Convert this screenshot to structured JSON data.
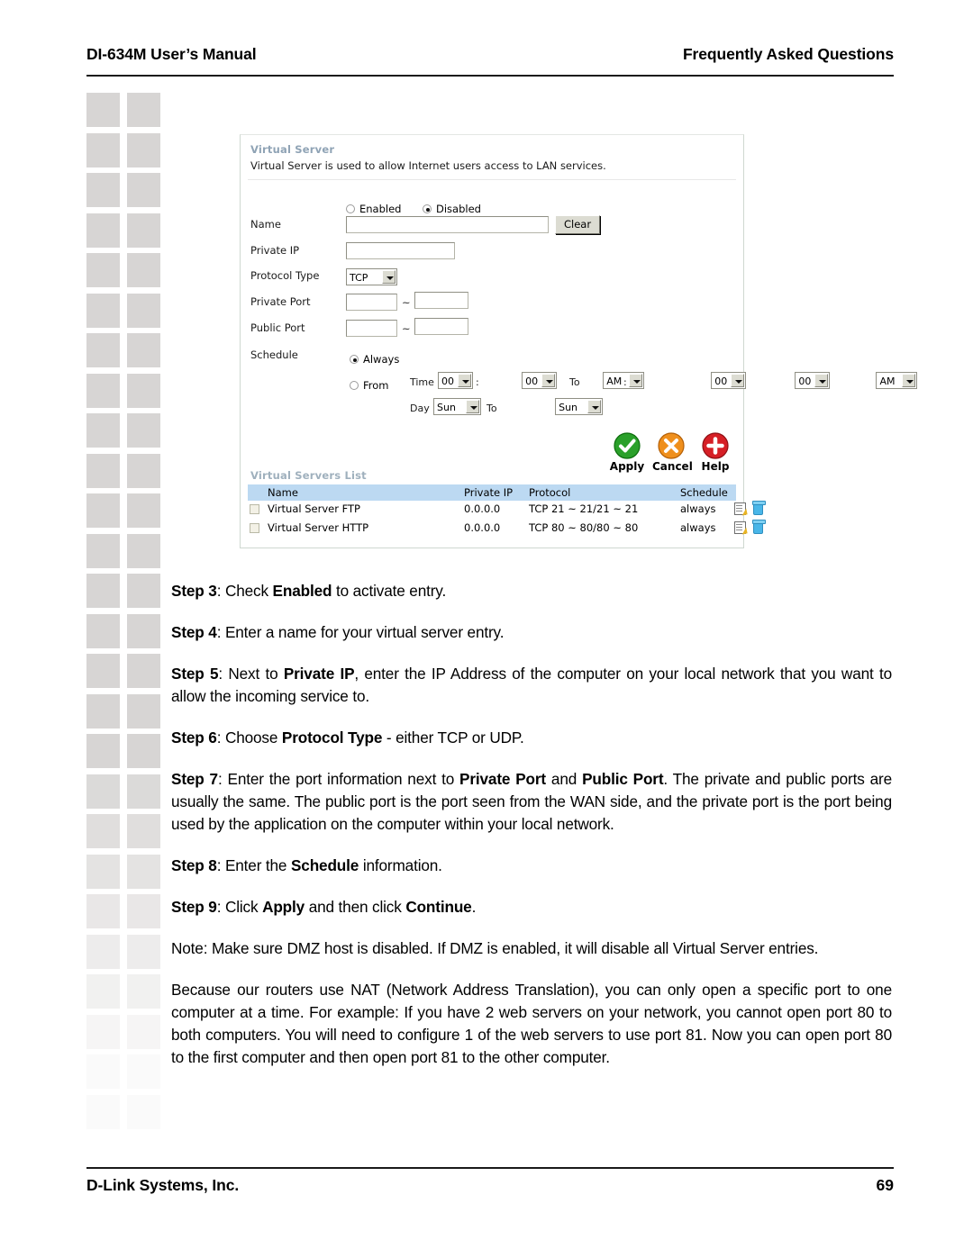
{
  "header": {
    "left": "DI-634M User’s Manual",
    "right": "Frequently Asked Questions"
  },
  "footer": {
    "left": "D-Link Systems, Inc.",
    "page_number": "69"
  },
  "screenshot": {
    "title": "Virtual Server",
    "description": "Virtual Server is used to allow Internet users access to LAN services.",
    "enable_radio": {
      "enabled_label": "Enabled",
      "disabled_label": "Disabled",
      "selected": "Disabled"
    },
    "fields": {
      "name_label": "Name",
      "name_value": "",
      "clear_button": "Clear",
      "private_ip_label": "Private IP",
      "private_ip_value": "",
      "protocol_type_label": "Protocol Type",
      "protocol_type_value": "TCP",
      "private_port_label": "Private Port",
      "private_port_from": "",
      "private_port_to": "",
      "public_port_label": "Public Port",
      "public_port_from": "",
      "public_port_to": "",
      "range_separator": "~"
    },
    "schedule": {
      "label": "Schedule",
      "always_label": "Always",
      "from_label": "From",
      "time_label": "Time",
      "to_label": "To",
      "day_label": "Day",
      "selected": "Always",
      "start_hour": "00",
      "start_minute": "00",
      "start_meridiem": "AM",
      "end_hour": "00",
      "end_minute": "00",
      "end_meridiem": "AM",
      "start_day": "Sun",
      "end_day": "Sun",
      "colon": ":"
    },
    "actions": [
      {
        "icon": "check-circle-icon",
        "label": "Apply",
        "color": "#2aa02a"
      },
      {
        "icon": "x-circle-icon",
        "label": "Cancel",
        "color": "#ef8f1c"
      },
      {
        "icon": "plus-circle-icon",
        "label": "Help",
        "color": "#d61f26"
      }
    ],
    "list": {
      "title": "Virtual Servers List",
      "columns": [
        "Name",
        "Private IP",
        "Protocol",
        "Schedule"
      ],
      "rows": [
        {
          "name": "Virtual Server FTP",
          "private_ip": "0.0.0.0",
          "protocol": "TCP 21 ~ 21/21 ~ 21",
          "schedule": "always"
        },
        {
          "name": "Virtual Server HTTP",
          "private_ip": "0.0.0.0",
          "protocol": "TCP 80 ~ 80/80 ~ 80",
          "schedule": "always"
        }
      ]
    },
    "colors": {
      "panel_heading": "#8fa3b5",
      "list_header_bg": "#bcd9f2",
      "apply_green": "#2aa02a",
      "cancel_orange": "#ef8f1c",
      "help_red": "#d61f26"
    }
  },
  "steps": [
    {
      "id": "step3",
      "html": "<b>Step 3</b>: Check <b>Enabled</b> to activate entry."
    },
    {
      "id": "step4",
      "html": "<b>Step 4</b>: Enter a name for your virtual server entry."
    },
    {
      "id": "step5",
      "html": "<b>Step 5</b>: Next to <b>Private IP</b>, enter the IP Address of the computer on your local network that you want to allow the incoming service to."
    },
    {
      "id": "step6",
      "html": "<b>Step 6</b>: Choose <b>Protocol Type</b> - either TCP or UDP."
    },
    {
      "id": "step7",
      "html": "<b>Step 7</b>: Enter the port information next to <b>Private Port</b> and <b>Public Port</b>. The private and public ports are usually the same. The public port is the port seen from the WAN side, and the private port is the port being used by the application on the computer within your local network."
    },
    {
      "id": "step8",
      "html": "<b>Step 8</b>: Enter the <b>Schedule</b> information."
    },
    {
      "id": "step9",
      "html": "<b>Step 9</b>: Click <b>Apply</b> and then click <b>Continue</b>."
    },
    {
      "id": "note",
      "html": "Note: Make sure DMZ host is disabled. If DMZ is enabled, it will disable all Virtual Server entries."
    },
    {
      "id": "nat-note",
      "html": "Because our routers use NAT (Network Address Translation), you can only open a specific port to one computer at a time. For example: If you have 2 web servers on your network, you cannot open port 80 to both computers. You will need to configure 1 of the web servers to use port 81. Now you can open port 80 to the first computer and then open port 81 to the other computer."
    }
  ]
}
